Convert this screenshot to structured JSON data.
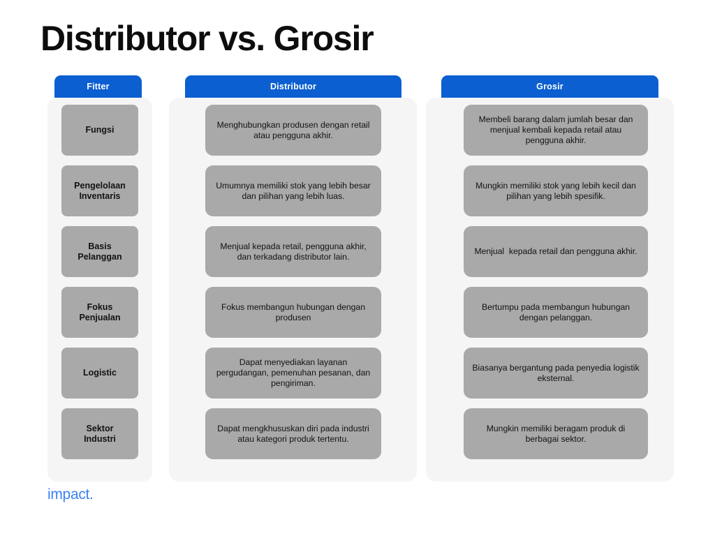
{
  "title": "Distributor vs. Grosir",
  "footer": {
    "logo_text": "impact."
  },
  "theme": {
    "header_blue": "#0b5fd0",
    "panel_gray": "#f5f5f5",
    "cell_gray": "#a9a9a9",
    "logo_blue": "#3b82f6",
    "title_color": "#0d0d0d"
  },
  "columns": [
    {
      "header": "Fitter",
      "cells": [
        "Fungsi",
        "Pengelolaan\nInventaris",
        "Basis\nPelanggan",
        "Fokus\nPenjualan",
        "Logistic",
        "Sektor\nIndustri"
      ]
    },
    {
      "header": "Distributor",
      "cells": [
        "Menghubungkan produsen dengan retail atau pengguna akhir.",
        "Umumnya memiliki stok yang lebih besar dan pilihan yang lebih luas.",
        "Menjual kepada retail, pengguna akhir, dan terkadang distributor lain.",
        "Fokus membangun hubungan dengan produsen",
        "Dapat menyediakan layanan pergudangan, pemenuhan pesanan, dan pengiriman.",
        "Dapat mengkhususkan diri pada industri atau kategori produk tertentu."
      ]
    },
    {
      "header": "Grosir",
      "cells": [
        "Membeli barang dalam jumlah besar dan menjual kembali kepada retail atau pengguna akhir.",
        "Mungkin memiliki stok yang lebih kecil dan pilihan yang lebih spesifik.",
        "Menjual  kepada retail dan pengguna akhir.",
        "Bertumpu pada membangun hubungan dengan pelanggan.",
        "Biasanya bergantung pada penyedia logistik eksternal.",
        "Mungkin memiliki beragam produk di berbagai sektor."
      ]
    }
  ]
}
